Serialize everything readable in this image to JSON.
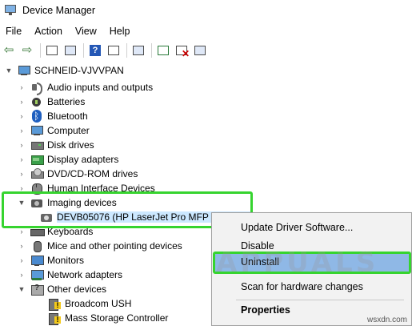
{
  "window": {
    "title": "Device Manager"
  },
  "menu": [
    "File",
    "Action",
    "View",
    "Help"
  ],
  "toolbar": {
    "icons": [
      "back-arrow-icon",
      "forward-arrow-icon",
      "properties-icon",
      "list-view-icon",
      "help-icon",
      "list-icon",
      "scan-hardware-icon",
      "update-driver-icon",
      "uninstall-device-icon",
      "enable-device-icon"
    ]
  },
  "tree": {
    "root": "SCHNEID-VJVVPAN",
    "categories": [
      {
        "label": "Audio inputs and outputs",
        "icon": "speaker-icon"
      },
      {
        "label": "Batteries",
        "icon": "battery-icon"
      },
      {
        "label": "Bluetooth",
        "icon": "bluetooth-icon"
      },
      {
        "label": "Computer",
        "icon": "computer-icon"
      },
      {
        "label": "Disk drives",
        "icon": "disk-drive-icon"
      },
      {
        "label": "Display adapters",
        "icon": "display-adapter-icon"
      },
      {
        "label": "DVD/CD-ROM drives",
        "icon": "dvd-drive-icon"
      },
      {
        "label": "Human Interface Devices",
        "icon": "hid-icon"
      },
      {
        "label": "Imaging devices",
        "icon": "camera-icon"
      },
      {
        "label": "Keyboards",
        "icon": "keyboard-icon"
      },
      {
        "label": "Mice and other pointing devices",
        "icon": "mouse-icon"
      },
      {
        "label": "Monitors",
        "icon": "monitor-icon"
      },
      {
        "label": "Network adapters",
        "icon": "network-adapter-icon"
      },
      {
        "label": "Other devices",
        "icon": "unknown-device-icon"
      }
    ],
    "imaging_child": "DEVB05076 (HP LaserJet Pro MFP M126nw)",
    "other_children": [
      "Broadcom USH",
      "Mass Storage Controller"
    ]
  },
  "context_menu": {
    "items": [
      "Update Driver Software...",
      "Disable",
      "Uninstall",
      "Scan for hardware changes",
      "Properties"
    ],
    "highlighted": "Uninstall"
  },
  "watermark": "APPUALS",
  "source_label": "wsxdn.com",
  "colors": {
    "highlight_box": "#36d42f",
    "menu_highlight": "#8fb8e6",
    "selection": "#cce8ff"
  }
}
